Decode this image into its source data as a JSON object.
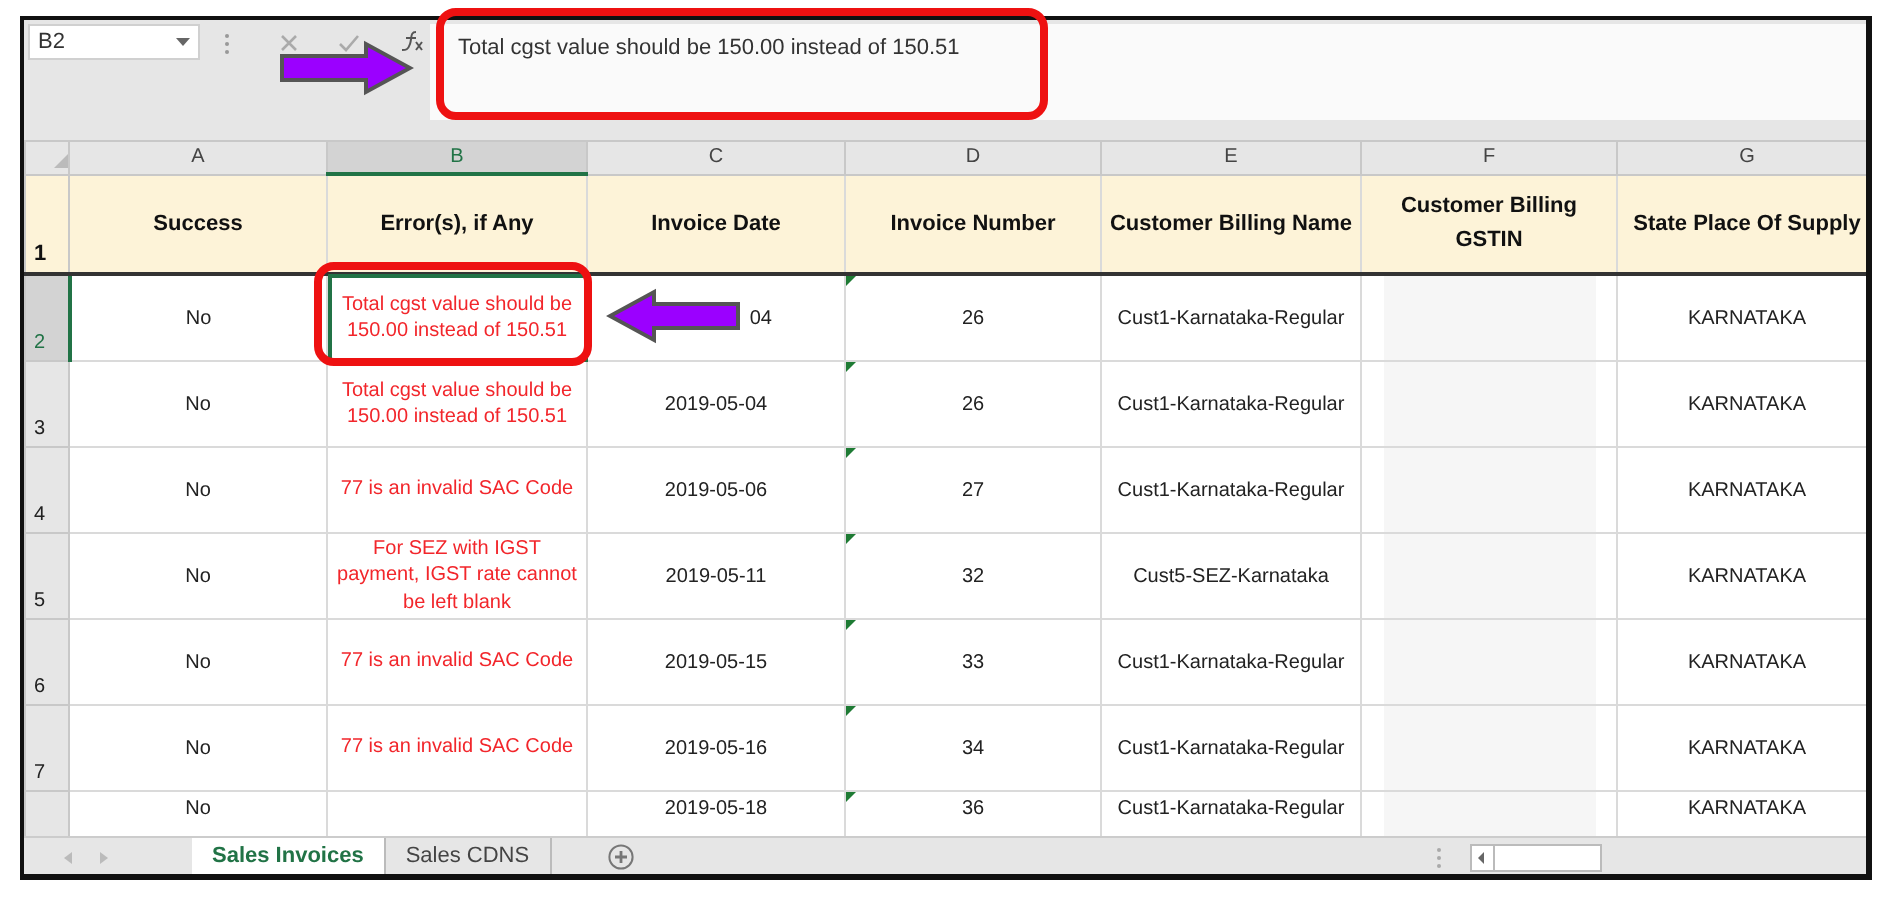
{
  "name_box": "B2",
  "formula": "Total cgst value should be 150.00 instead of 150.51",
  "column_letters": [
    {
      "label": "A",
      "selected": false
    },
    {
      "label": "B",
      "selected": true
    },
    {
      "label": "C",
      "selected": false
    },
    {
      "label": "D",
      "selected": false
    },
    {
      "label": "E",
      "selected": false
    },
    {
      "label": "F",
      "selected": false
    },
    {
      "label": "G",
      "selected": false
    }
  ],
  "header_row_number": "1",
  "headers": [
    "Success",
    "Error(s), if Any",
    "Invoice Date",
    "Invoice Number",
    "Customer Billing Name",
    "Customer Billing GSTIN",
    "State Place Of Supply"
  ],
  "rows": [
    {
      "row_number": "2",
      "selected": true,
      "success": "No",
      "error": "Total cgst value should be 150.00 instead of 150.51",
      "error_selected": true,
      "date": "04",
      "date_covered": true,
      "invoice_number": "26",
      "customer": "Cust1-Karnataka-Regular",
      "gstin_redacted": true,
      "state": "KARNATAKA"
    },
    {
      "row_number": "3",
      "selected": false,
      "success": "No",
      "error": "Total cgst value should be 150.00 instead of 150.51",
      "error_selected": false,
      "date": "2019-05-04",
      "date_covered": false,
      "invoice_number": "26",
      "customer": "Cust1-Karnataka-Regular",
      "gstin_redacted": true,
      "state": "KARNATAKA"
    },
    {
      "row_number": "4",
      "selected": false,
      "success": "No",
      "error": "77 is an invalid SAC Code",
      "error_selected": false,
      "date": "2019-05-06",
      "date_covered": false,
      "invoice_number": "27",
      "customer": "Cust1-Karnataka-Regular",
      "gstin_redacted": true,
      "state": "KARNATAKA"
    },
    {
      "row_number": "5",
      "selected": false,
      "success": "No",
      "error": "For SEZ with IGST payment, IGST rate cannot be left blank",
      "error_selected": false,
      "date": "2019-05-11",
      "date_covered": false,
      "invoice_number": "32",
      "customer": "Cust5-SEZ-Karnataka",
      "gstin_redacted": true,
      "state": "KARNATAKA"
    },
    {
      "row_number": "6",
      "selected": false,
      "success": "No",
      "error": "77 is an invalid SAC Code",
      "error_selected": false,
      "date": "2019-05-15",
      "date_covered": false,
      "invoice_number": "33",
      "customer": "Cust1-Karnataka-Regular",
      "gstin_redacted": true,
      "state": "KARNATAKA"
    },
    {
      "row_number": "7",
      "selected": false,
      "success": "No",
      "error": "77 is an invalid SAC Code",
      "error_selected": false,
      "date": "2019-05-16",
      "date_covered": false,
      "invoice_number": "34",
      "customer": "Cust1-Karnataka-Regular",
      "gstin_redacted": true,
      "state": "KARNATAKA"
    },
    {
      "selected": false,
      "success": "No",
      "error_selected": false,
      "date": "2019-05-18",
      "date_covered": false,
      "invoice_number": "36",
      "customer": "Cust1-Karnataka-Regular",
      "gstin_redacted": true,
      "state": "KARNATAKA"
    }
  ],
  "sheet_tabs": [
    {
      "label": "Sales Invoices",
      "selected": true
    },
    {
      "label": "Sales CDNS",
      "selected": false
    }
  ],
  "callouts": [
    {
      "kind": "box"
    },
    {
      "kind": "arrow"
    },
    {
      "kind": "box"
    },
    {
      "kind": "arrow"
    }
  ]
}
